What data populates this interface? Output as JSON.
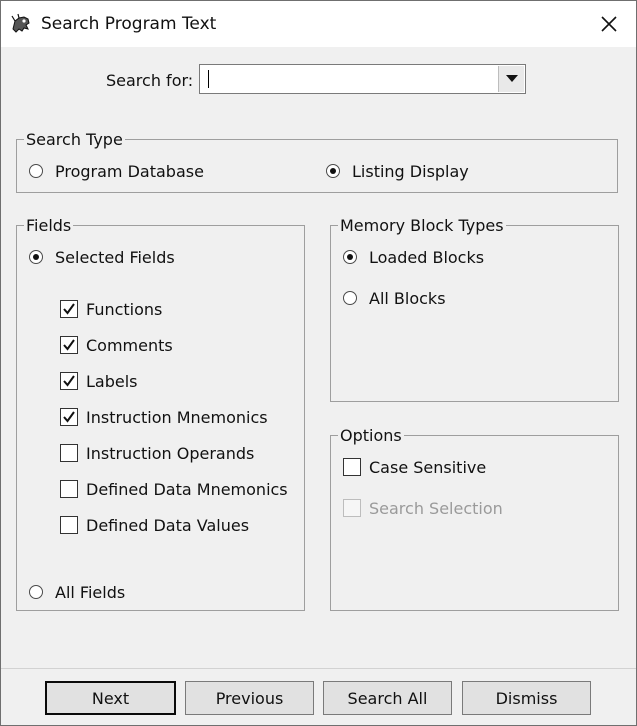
{
  "window": {
    "title": "Search Program Text",
    "close_icon": "close-icon"
  },
  "search": {
    "label": "Search for:",
    "value": ""
  },
  "search_type": {
    "legend": "Search Type",
    "options": [
      {
        "label": "Program Database",
        "selected": false
      },
      {
        "label": "Listing Display",
        "selected": true
      }
    ]
  },
  "fields": {
    "legend": "Fields",
    "selected_fields_label": "Selected Fields",
    "selected_fields_on": true,
    "checkboxes": [
      {
        "label": "Functions",
        "checked": true
      },
      {
        "label": "Comments",
        "checked": true
      },
      {
        "label": "Labels",
        "checked": true
      },
      {
        "label": "Instruction Mnemonics",
        "checked": true
      },
      {
        "label": "Instruction Operands",
        "checked": false
      },
      {
        "label": "Defined Data Mnemonics",
        "checked": false
      },
      {
        "label": "Defined Data Values",
        "checked": false
      }
    ],
    "all_fields_label": "All Fields"
  },
  "memory_block_types": {
    "legend": "Memory Block Types",
    "options": [
      {
        "label": "Loaded Blocks",
        "selected": true
      },
      {
        "label": "All Blocks",
        "selected": false
      }
    ]
  },
  "options": {
    "legend": "Options",
    "case_sensitive": {
      "label": "Case Sensitive",
      "checked": false
    },
    "search_selection": {
      "label": "Search Selection",
      "checked": false,
      "enabled": false
    }
  },
  "buttons": {
    "next": "Next",
    "previous": "Previous",
    "search_all": "Search All",
    "dismiss": "Dismiss"
  }
}
